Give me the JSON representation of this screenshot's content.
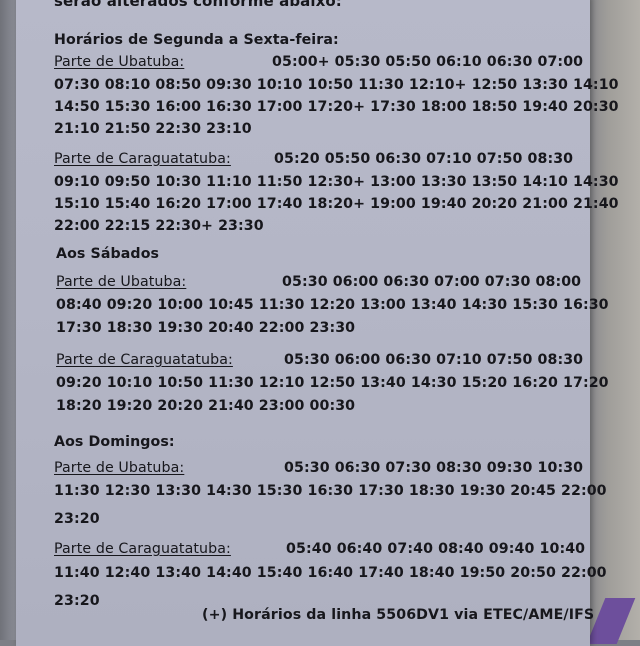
{
  "intro_text": "serão alterados conforme abaixo:",
  "weekday": {
    "heading": "Horários de Segunda a Sexta-feira:",
    "from_ubatuba": {
      "label": "Parte de Ubatuba:",
      "lines": [
        "05:00+ 05:30 05:50 06:10 06:30 07:00",
        "07:30 08:10 08:50 09:30 10:10 10:50 11:30 12:10+ 12:50 13:30 14:10",
        "14:50 15:30 16:00 16:30 17:00 17:20+ 17:30 18:00 18:50 19:40 20:30",
        "21:10 21:50 22:30 23:10"
      ]
    },
    "from_caraguatatuba": {
      "label": "Parte de Caraguatatuba:",
      "lines": [
        "05:20 05:50 06:30 07:10 07:50 08:30",
        "09:10 09:50 10:30 11:10 11:50 12:30+ 13:00 13:30 13:50 14:10 14:30",
        "15:10 15:40 16:20 17:00 17:40 18:20+ 19:00 19:40 20:20 21:00 21:40",
        "22:00 22:15 22:30+ 23:30"
      ]
    }
  },
  "saturday": {
    "heading": "Aos Sábados",
    "from_ubatuba": {
      "label": "Parte de Ubatuba:",
      "lines": [
        "05:30 06:00 06:30 07:00 07:30 08:00",
        "08:40 09:20 10:00 10:45 11:30 12:20 13:00 13:40 14:30 15:30 16:30",
        "17:30 18:30 19:30 20:40 22:00 23:30"
      ]
    },
    "from_caraguatatuba": {
      "label": "Parte de Caraguatatuba:",
      "lines": [
        "05:30 06:00 06:30 07:10 07:50 08:30",
        "09:20 10:10 10:50 11:30 12:10 12:50 13:40 14:30 15:20 16:20 17:20",
        "18:20 19:20 20:20 21:40 23:00 00:30"
      ]
    }
  },
  "sunday": {
    "heading": "Aos Domingos:",
    "from_ubatuba": {
      "label": "Parte de Ubatuba:",
      "lines": [
        "05:30 06:30 07:30 08:30 09:30 10:30",
        "11:30 12:30 13:30 14:30 15:30 16:30 17:30 18:30 19:30 20:45 22:00",
        "23:20"
      ]
    },
    "from_caraguatatuba": {
      "label": "Parte de Caraguatatuba:",
      "lines": [
        "05:40 06:40 07:40 08:40 09:40 10:40",
        "11:40 12:40 13:40 14:40 15:40 16:40 17:40 18:40 19:50 20:50 22:00",
        "23:20"
      ]
    }
  },
  "footnote": "(+) Horários da linha 5506DV1 via ETEC/AME/IFS"
}
